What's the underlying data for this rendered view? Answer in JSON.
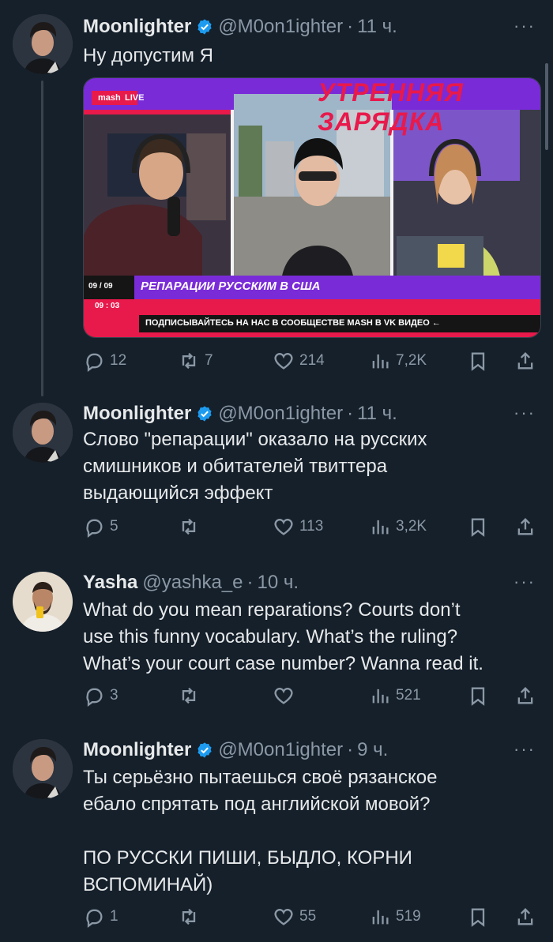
{
  "tweets": [
    {
      "name": "Moonlighter",
      "handle": "@M0on1ighter",
      "time": "11 ч.",
      "text": "Ну допустим Я",
      "replies": "12",
      "retweets": "7",
      "likes": "214",
      "views": "7,2K",
      "media": {
        "brand": "mash",
        "live": "LIVE",
        "headline": "РЕПАРАЦИИ РУССКИМ В США",
        "date1": "09 / 09",
        "date2": "09 : 03",
        "ticker": "ПОДПИСЫВАЙТЕСЬ НА НАС В СООБЩЕСТВЕ MASH В VK ВИДЕО ←",
        "show_title": "УТРЕННЯЯ ЗАРЯДКА",
        "show_small": "УТРЕННЯЯ",
        "show_small2": "ЗАРЯДКА"
      }
    },
    {
      "name": "Moonlighter",
      "handle": "@M0on1ighter",
      "time": "11 ч.",
      "text": "Слово \"репарации\" оказало на русских\nсмишников и обитателей твиттера\nвыдающийся эффект",
      "replies": "5",
      "retweets": "",
      "likes": "113",
      "views": "3,2K"
    },
    {
      "name": "Yasha",
      "handle": "@yashka_e",
      "time": "10 ч.",
      "text": "What do you mean reparations? Courts don’t\nuse this funny vocabulary. What’s the ruling?\nWhat’s your court case number? Wanna read it.",
      "replies": "3",
      "retweets": "",
      "likes": "",
      "views": "521"
    },
    {
      "name": "Moonlighter",
      "handle": "@M0on1ighter",
      "time": "9 ч.",
      "text": "Ты серьёзно пытаешься своё рязанское\nебало спрятать под английской мовой?\n\nПО РУССКИ ПИШИ, БЫДЛО, КОРНИ\nВСПОМИНАЙ)",
      "replies": "1",
      "retweets": "",
      "likes": "55",
      "views": "519"
    }
  ],
  "more_label": "···",
  "dot": "·",
  "colors": {
    "background": "#15202b",
    "text": "#e7e9ea",
    "muted": "#8b98a5",
    "verified": "#1d9bf0",
    "accent_red": "#e8194b",
    "accent_purple": "#7a2bd8"
  }
}
